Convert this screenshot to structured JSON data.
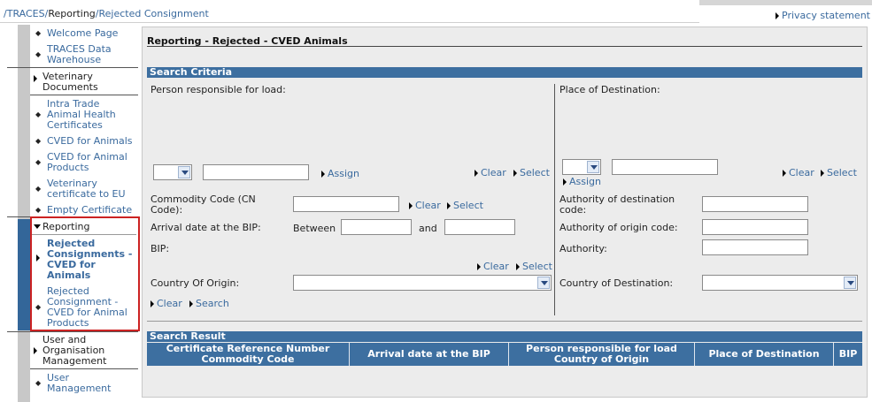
{
  "breadcrumb": {
    "sep": "/",
    "traces": "TRACES",
    "reporting": "Reporting",
    "current": "Rejected Consignment"
  },
  "privacy": "Privacy statement",
  "nav": {
    "welcome": "Welcome Page",
    "dw": [
      "TRACES Data",
      "Warehouse"
    ],
    "vetdocs": [
      "Veterinary",
      "Documents"
    ],
    "intra": [
      "Intra Trade",
      "Animal Health",
      "Certificates"
    ],
    "cved_animals": "CVED for Animals",
    "cved_products": [
      "CVED for Animal",
      "Products"
    ],
    "vet_cert": [
      "Veterinary",
      "certificate to EU"
    ],
    "empty_cert": "Empty Certificate",
    "reporting": "Reporting",
    "rej_animals": [
      "Rejected",
      "Consignments -",
      "CVED for",
      "Animals"
    ],
    "rej_products": [
      "Rejected",
      "Consignment -",
      "CVED for Animal",
      "Products"
    ],
    "user_org": [
      "User and",
      "Organisation",
      "Management"
    ],
    "user_mgmt": [
      "User",
      "Management"
    ]
  },
  "page_title": "Reporting - Rejected - CVED Animals",
  "search_criteria": "Search Criteria",
  "search_result": "Search Result",
  "form": {
    "person_label": "Person responsible for load:",
    "place_label": "Place of Destination:",
    "assign": "Assign",
    "clear": "Clear",
    "select": "Select",
    "search": "Search",
    "commodity_label": [
      "Commodity Code (CN",
      "Code):"
    ],
    "arrival_label": "Arrival date at the BIP:",
    "between": "Between",
    "and": "and",
    "bip_label": "BIP:",
    "country_origin_label": "Country Of Origin:",
    "auth_dest_label": [
      "Authority of destination",
      "code:"
    ],
    "auth_origin_label": "Authority of origin code:",
    "authority_label": "Authority:",
    "country_dest_label": "Country of Destination:"
  },
  "table": {
    "columns": [
      [
        "Certificate Reference Number",
        "Commodity Code"
      ],
      [
        "Arrival date at the BIP"
      ],
      [
        "Person responsible for load",
        "Country of Origin"
      ],
      [
        "Place of Destination"
      ],
      [
        "BIP"
      ]
    ]
  }
}
